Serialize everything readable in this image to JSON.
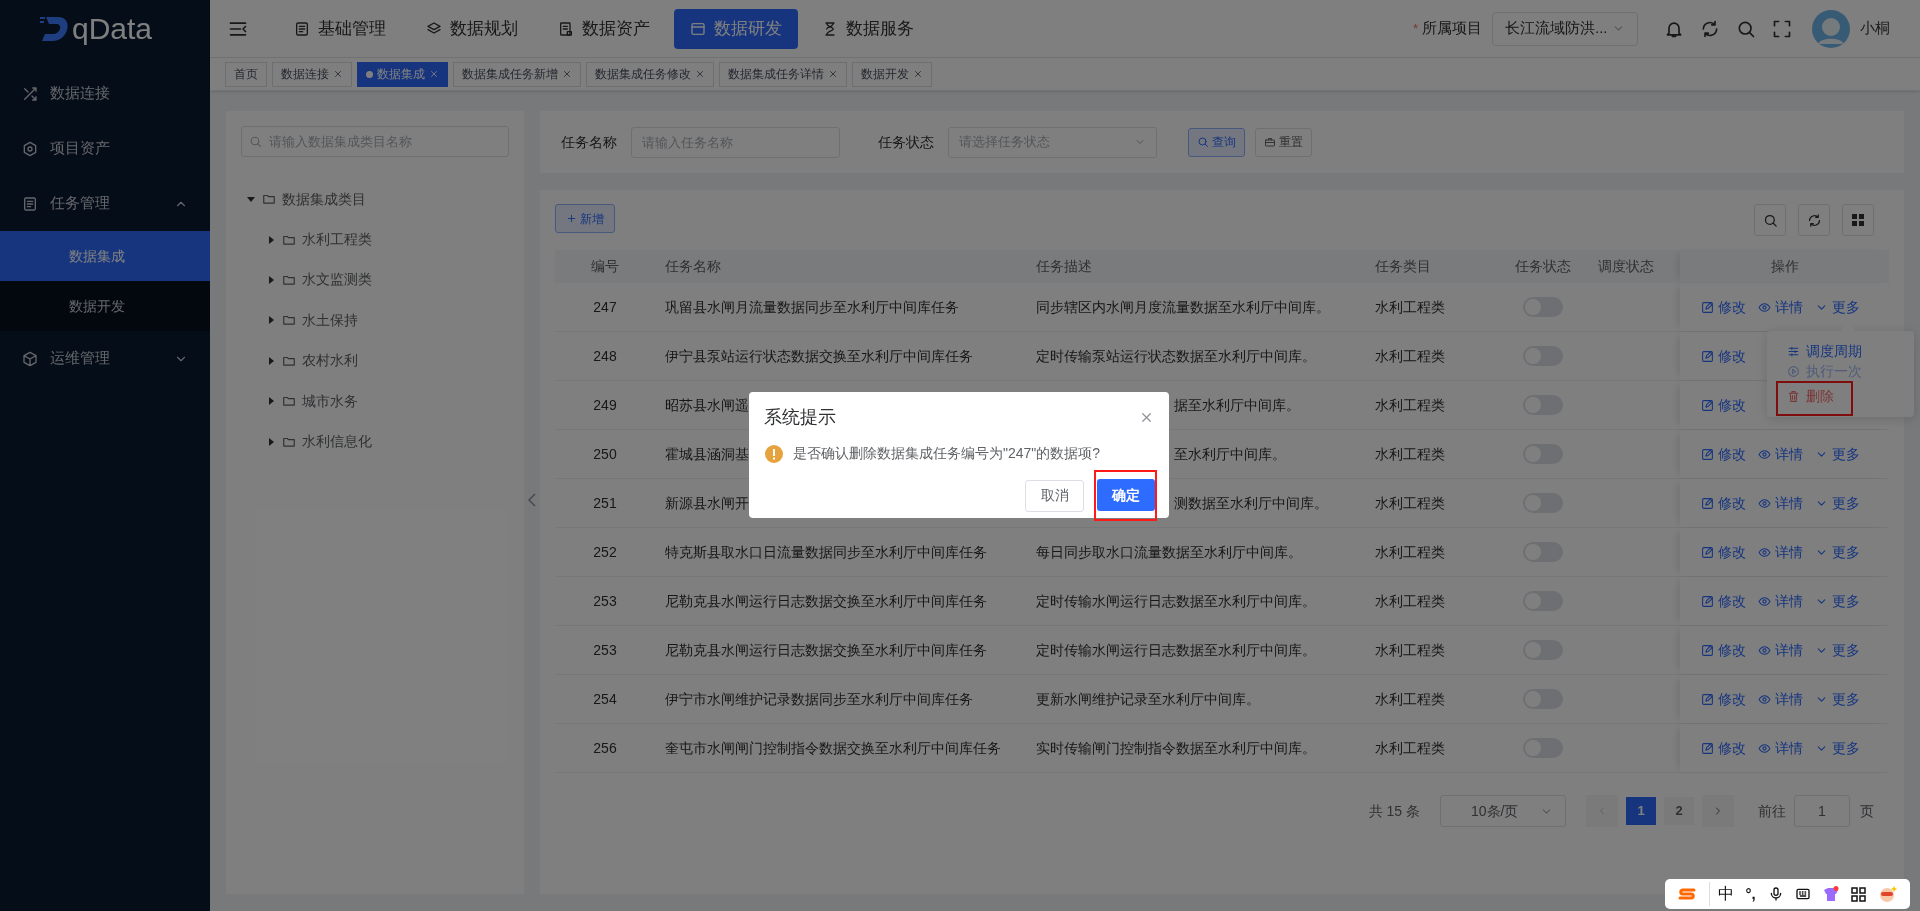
{
  "logo": {
    "text": "qData"
  },
  "sidebar": {
    "items": [
      {
        "label": "数据连接",
        "selected": false
      },
      {
        "label": "项目资产",
        "selected": false
      },
      {
        "label": "任务管理",
        "selected": false,
        "expanded": true,
        "children": [
          {
            "label": "数据集成",
            "selected": true
          },
          {
            "label": "数据开发",
            "selected": false
          }
        ]
      },
      {
        "label": "运维管理",
        "selected": false,
        "expanded": false
      }
    ]
  },
  "top_nav": {
    "items": [
      {
        "label": "基础管理",
        "selected": false
      },
      {
        "label": "数据规划",
        "selected": false
      },
      {
        "label": "数据资产",
        "selected": false
      },
      {
        "label": "数据研发",
        "selected": true
      },
      {
        "label": "数据服务",
        "selected": false
      }
    ]
  },
  "project": {
    "required_mark": "*",
    "label": "所属项目",
    "value": "长江流域防洪..."
  },
  "user": {
    "name": "小桐"
  },
  "page_tabs": [
    {
      "label": "首页",
      "selected": false,
      "closable": false
    },
    {
      "label": "数据连接",
      "selected": false,
      "closable": true
    },
    {
      "label": "数据集成",
      "selected": true,
      "closable": true
    },
    {
      "label": "数据集成任务新增",
      "selected": false,
      "closable": true
    },
    {
      "label": "数据集成任务修改",
      "selected": false,
      "closable": true
    },
    {
      "label": "数据集成任务详情",
      "selected": false,
      "closable": true
    },
    {
      "label": "数据开发",
      "selected": false,
      "closable": true
    }
  ],
  "tree": {
    "search_placeholder": "请输入数据集成类目名称",
    "nodes": [
      {
        "label": "数据集成类目",
        "expanded": true,
        "children": [
          {
            "label": "水利工程类",
            "expanded": false
          },
          {
            "label": "水文监测类",
            "expanded": false
          },
          {
            "label": "水土保持",
            "expanded": false
          },
          {
            "label": "农村水利",
            "expanded": false
          },
          {
            "label": "城市水务",
            "expanded": false
          },
          {
            "label": "水利信息化",
            "expanded": false
          }
        ]
      }
    ]
  },
  "search_form": {
    "fields": [
      {
        "label": "任务名称",
        "kind": "input",
        "placeholder": "请输入任务名称"
      },
      {
        "label": "任务状态",
        "kind": "select",
        "placeholder": "请选择任务状态"
      }
    ],
    "buttons": [
      {
        "label": "查询",
        "kind": "primary"
      },
      {
        "label": "重置",
        "kind": "default"
      }
    ]
  },
  "add_button": "新增",
  "table": {
    "columns": [
      "编号",
      "任务名称",
      "任务描述",
      "任务类目",
      "任务状态",
      "调度状态",
      "操作"
    ],
    "rows": [
      {
        "id": "247",
        "name": "巩留县水闸月流量数据同步至水利厅中间库任务",
        "description": "同步辖区内水闸月度流量数据至水利厅中间库。",
        "category": "水利工程类",
        "status_on": false,
        "covered": false,
        "actions": [
          "修改",
          "详情",
          "更多"
        ]
      },
      {
        "id": "248",
        "name": "伊宁县泵站运行状态数据交换至水利厅中间库任务",
        "description": "定时传输泵站运行状态数据至水利厅中间库。",
        "category": "水利工程类",
        "status_on": false,
        "covered": false,
        "actions": [
          "修改"
        ]
      },
      {
        "id": "249",
        "name": "昭苏县水闸遥",
        "description": "据至水利厅中间库。",
        "category": "水利工程类",
        "status_on": false,
        "covered": true,
        "actions": [
          "修改"
        ]
      },
      {
        "id": "250",
        "name": "霍城县涵洞基",
        "description": "至水利厅中间库。",
        "category": "水利工程类",
        "status_on": false,
        "covered": true,
        "actions": [
          "修改",
          "详情",
          "更多"
        ]
      },
      {
        "id": "251",
        "name": "新源县水闸开",
        "description": "测数据至水利厅中间库。",
        "category": "水利工程类",
        "status_on": false,
        "covered": true,
        "actions": [
          "修改",
          "详情",
          "更多"
        ]
      },
      {
        "id": "252",
        "name": "特克斯县取水口日流量数据同步至水利厅中间库任务",
        "description": "每日同步取水口流量数据至水利厅中间库。",
        "category": "水利工程类",
        "status_on": false,
        "covered": false,
        "actions": [
          "修改",
          "详情",
          "更多"
        ]
      },
      {
        "id": "253",
        "name": "尼勒克县水闸运行日志数据交换至水利厅中间库任务",
        "description": "定时传输水闸运行日志数据至水利厅中间库。",
        "category": "水利工程类",
        "status_on": false,
        "covered": false,
        "actions": [
          "修改",
          "详情",
          "更多"
        ]
      },
      {
        "id": "253",
        "name": "尼勒克县水闸运行日志数据交换至水利厅中间库任务",
        "description": "定时传输水闸运行日志数据至水利厅中间库。",
        "category": "水利工程类",
        "status_on": false,
        "covered": false,
        "actions": [
          "修改",
          "详情",
          "更多"
        ]
      },
      {
        "id": "254",
        "name": "伊宁市水闸维护记录数据同步至水利厅中间库任务",
        "description": "更新水闸维护记录至水利厅中间库。",
        "category": "水利工程类",
        "status_on": false,
        "covered": false,
        "actions": [
          "修改",
          "详情",
          "更多"
        ]
      },
      {
        "id": "256",
        "name": "奎屯市水闸闸门控制指令数据交换至水利厅中间库任务",
        "description": "实时传输闸门控制指令数据至水利厅中间库。",
        "category": "水利工程类",
        "status_on": false,
        "covered": false,
        "actions": [
          "修改",
          "详情",
          "更多"
        ]
      }
    ]
  },
  "row_menu": {
    "items": [
      {
        "label": "调度周期",
        "disabled": false,
        "danger": false,
        "highlighted": false
      },
      {
        "label": "执行一次",
        "disabled": true,
        "danger": false,
        "highlighted": false
      },
      {
        "label": "删除",
        "disabled": false,
        "danger": true,
        "highlighted": true
      }
    ]
  },
  "pagination": {
    "total": "共 15 条",
    "page_size": "10条/页",
    "pages": [
      {
        "label": "1",
        "selected": true
      },
      {
        "label": "2",
        "selected": false
      }
    ],
    "goto_label": "前往",
    "goto_value": "1",
    "page_suffix": "页"
  },
  "dialog": {
    "title": "系统提示",
    "message": "是否确认删除数据集成任务编号为\"247\"的数据项?",
    "buttons": [
      {
        "label": "取消",
        "kind": "default",
        "highlighted": false
      },
      {
        "label": "确定",
        "kind": "primary",
        "highlighted": true
      }
    ]
  },
  "ime_toolbar": {
    "mode": "中",
    "punctuation": "°,"
  }
}
